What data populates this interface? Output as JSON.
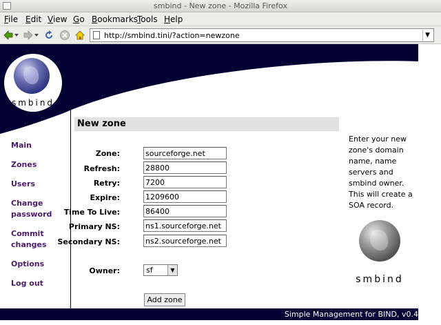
{
  "window": {
    "title": "smbind - New zone - Mozilla Firefox"
  },
  "menubar": {
    "items": [
      {
        "label": "File",
        "key": "F",
        "rest": "ile"
      },
      {
        "label": "Edit",
        "key": "E",
        "rest": "dit"
      },
      {
        "label": "View",
        "key": "V",
        "rest": "iew"
      },
      {
        "label": "Go",
        "key": "G",
        "rest": "o"
      },
      {
        "label": "Bookmarks",
        "key": "B",
        "rest": "ookmarks"
      },
      {
        "label": "Tools",
        "key": "T",
        "rest": "ools"
      },
      {
        "label": "Help",
        "key": "H",
        "rest": "elp"
      }
    ]
  },
  "navbar": {
    "url": "http://smbind.tini/?action=newzone",
    "icons": [
      "back-icon",
      "forward-icon",
      "reload-icon",
      "stop-icon",
      "home-icon"
    ]
  },
  "logo": {
    "brand": "smbind"
  },
  "sidenav": {
    "items": [
      {
        "label": "Main"
      },
      {
        "label": "Zones"
      },
      {
        "label": "Users"
      },
      {
        "label": "Change password"
      },
      {
        "label": "Commit changes"
      },
      {
        "label": "Options"
      },
      {
        "label": "Log out"
      }
    ]
  },
  "form": {
    "heading": "New zone",
    "fields": [
      {
        "label": "Zone:",
        "value": "sourceforge.net"
      },
      {
        "label": "Refresh:",
        "value": "28800"
      },
      {
        "label": "Retry:",
        "value": "7200"
      },
      {
        "label": "Expire:",
        "value": "1209600"
      },
      {
        "label": "Time To Live:",
        "value": "86400"
      },
      {
        "label": "Primary NS:",
        "value": "ns1.sourceforge.net"
      },
      {
        "label": "Secondary NS:",
        "value": "ns2.sourceforge.net"
      }
    ],
    "owner_label": "Owner:",
    "owner_value": "sf",
    "submit_label": "Add zone"
  },
  "help": {
    "text": "Enter your new zone's domain name, name servers and smbind owner. This will create a SOA record."
  },
  "sidebar_brand": "smbind",
  "footer": {
    "text": "Simple Management for BIND, v0.4"
  },
  "colors": {
    "header_navy": "#000033",
    "nav_link": "#4a1c6a",
    "section_bg": "#e2e2e2"
  }
}
